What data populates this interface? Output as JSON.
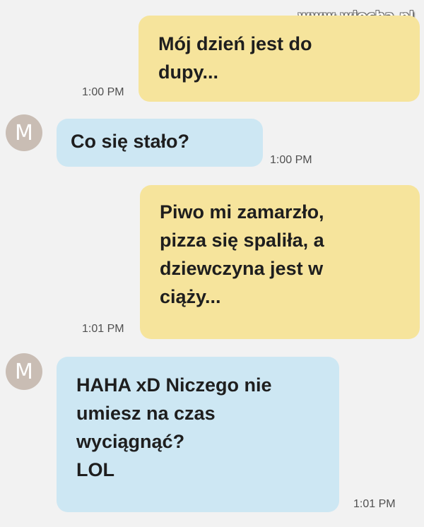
{
  "watermark": "www.wiocha.pl",
  "messages": [
    {
      "direction": "outgoing",
      "text": "Mój dzień jest do\ndupy...",
      "time": "1:00 PM"
    },
    {
      "direction": "incoming",
      "avatar": "M",
      "text": "Co się stało?",
      "time": "1:00 PM"
    },
    {
      "direction": "outgoing",
      "text": "Piwo mi zamarzło,\npizza się spaliła, a\ndziewczyna jest w\nciąży...",
      "time": "1:01 PM"
    },
    {
      "direction": "incoming",
      "avatar": "M",
      "text": "HAHA xD Niczego nie\numiesz na czas\nwyciągnąć?\nLOL",
      "time": "1:01 PM"
    }
  ],
  "colors": {
    "background": "#f2f2f2",
    "outgoing_bubble": "#f6e49c",
    "incoming_bubble": "#cde7f3",
    "avatar": "#c9bdb4"
  }
}
